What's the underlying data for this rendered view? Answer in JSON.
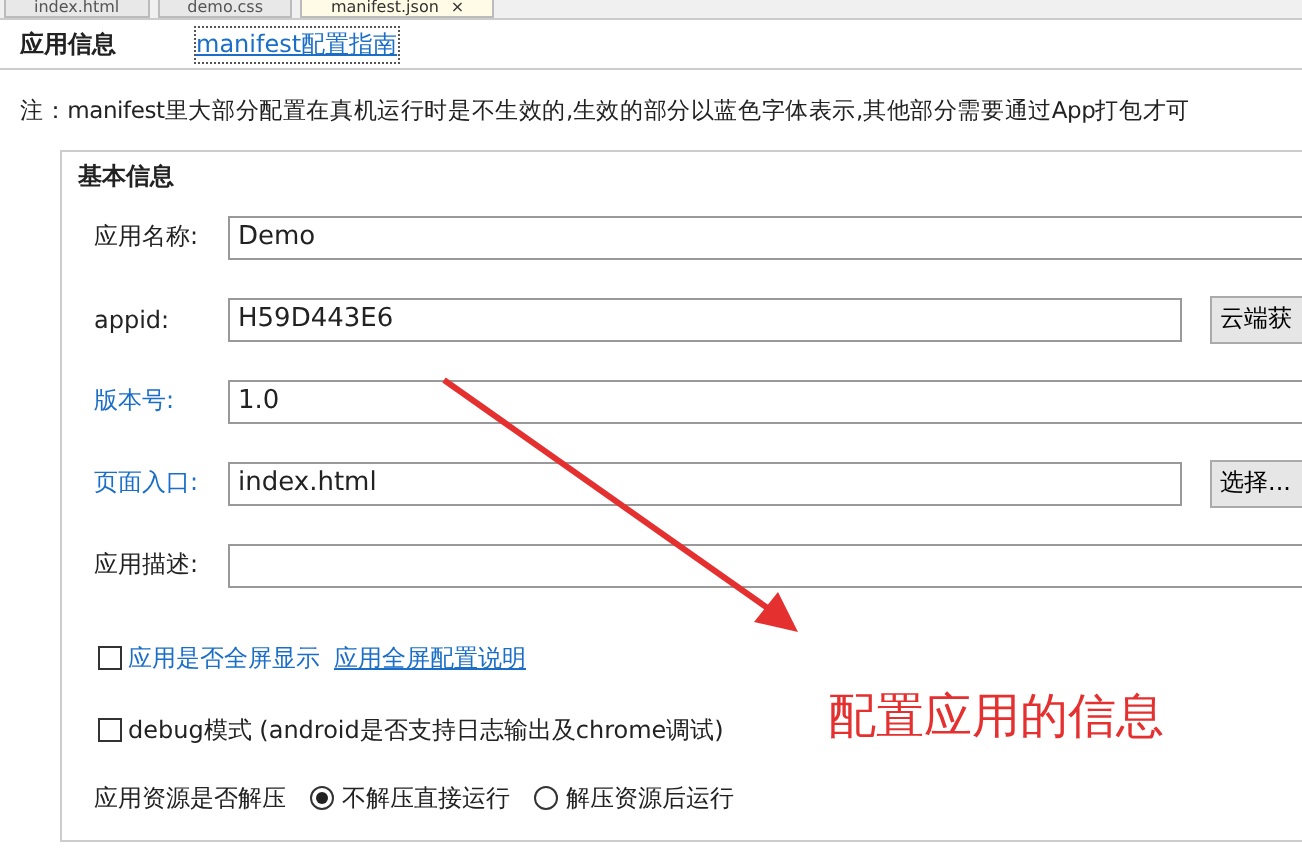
{
  "tabs": [
    {
      "label": "index.html",
      "selected": false
    },
    {
      "label": "demo.css",
      "selected": false
    },
    {
      "label": "manifest.json",
      "selected": true,
      "close": "×"
    }
  ],
  "header": {
    "title": "应用信息",
    "link": "manifest配置指南"
  },
  "note": "注：manifest里大部分配置在真机运行时是不生效的,生效的部分以蓝色字体表示,其他部分需要通过App打包才可",
  "group": {
    "title": "基本信息",
    "fields": [
      {
        "label": "应用名称:",
        "value": "Demo",
        "effective": false
      },
      {
        "label": "appid:",
        "value": "H59D443E6",
        "effective": false,
        "button": "云端获"
      },
      {
        "label": "版本号:",
        "value": "1.0",
        "effective": true
      },
      {
        "label": "页面入口:",
        "value": "index.html",
        "effective": true,
        "button": "选择..."
      },
      {
        "label": "应用描述:",
        "effective": false
      }
    ],
    "checkboxes": [
      {
        "label": "应用是否全屏显示",
        "effective": true,
        "checked": false,
        "link": "应用全屏配置说明"
      },
      {
        "label": "debug模式 (android是否支持日志输出及chrome调试)",
        "effective": false,
        "checked": false
      }
    ],
    "radio_group": {
      "label": "应用资源是否解压",
      "options": [
        {
          "label": "不解压直接运行",
          "selected": true
        },
        {
          "label": "解压资源后运行",
          "selected": false
        }
      ]
    }
  },
  "annotation": {
    "text": "配置应用的信息"
  }
}
